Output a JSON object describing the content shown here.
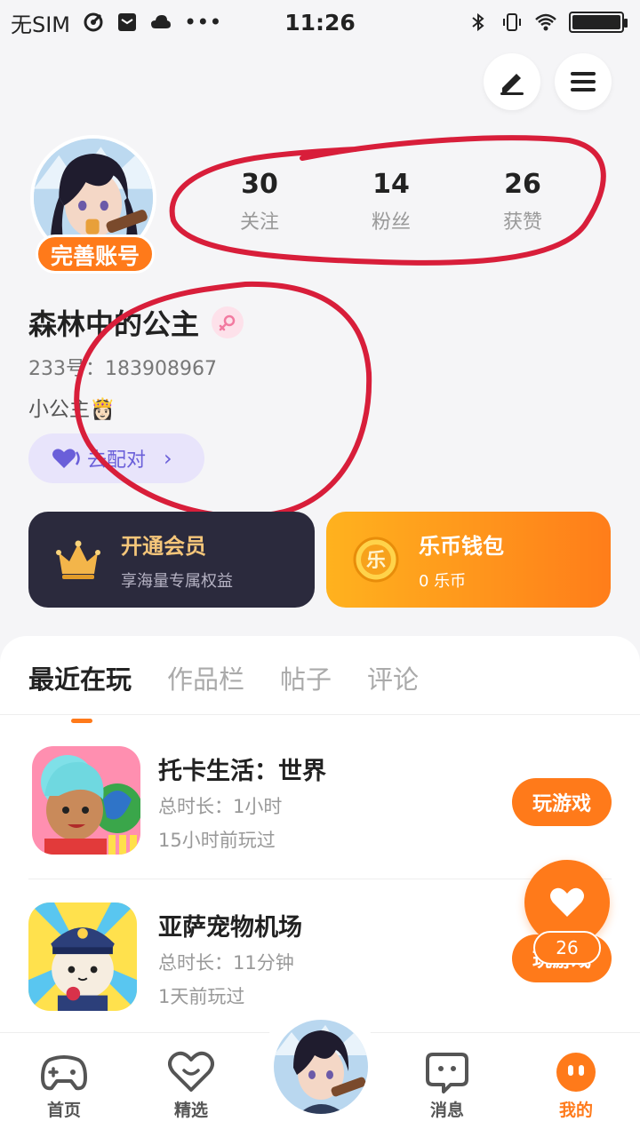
{
  "status_bar": {
    "carrier": "无SIM",
    "time": "11:26",
    "battery_level": 1.0
  },
  "profile": {
    "complete_label": "完善账号",
    "username": "森林中的公主",
    "user_id": "233号：183908967",
    "bio": "小公主👸🏻",
    "match_label": "去配对",
    "stats": [
      {
        "value": "30",
        "label": "关注"
      },
      {
        "value": "14",
        "label": "粉丝"
      },
      {
        "value": "26",
        "label": "获赞"
      }
    ]
  },
  "cards": {
    "vip": {
      "title": "开通会员",
      "subtitle": "享海量专属权益",
      "icon": "crown-icon"
    },
    "wallet": {
      "title": "乐币钱包",
      "subtitle": "0 乐币",
      "icon": "coin-icon",
      "coin_char": "乐"
    }
  },
  "tabs": [
    "最近在玩",
    "作品栏",
    "帖子",
    "评论"
  ],
  "games": [
    {
      "name": "托卡生活：世界",
      "duration": "总时长：1小时",
      "last_played": "15小时前玩过",
      "button": "玩游戏"
    },
    {
      "name": "亚萨宠物机场",
      "duration": "总时长：11分钟",
      "last_played": "1天前玩过",
      "button": "玩游戏"
    }
  ],
  "fab": {
    "count": "26",
    "icon": "heart-icon"
  },
  "bottom_nav": [
    {
      "label": "首页",
      "icon": "gamepad-icon"
    },
    {
      "label": "精选",
      "icon": "heart-chat-icon"
    },
    {
      "label": "消息",
      "icon": "message-icon"
    },
    {
      "label": "我的",
      "icon": "profile-face-icon"
    }
  ],
  "colors": {
    "accent": "#ff7a1a",
    "vip_bg": "#2b2a3d",
    "vip_gold": "#f5c67a",
    "annotation_red": "#d81e3a"
  }
}
